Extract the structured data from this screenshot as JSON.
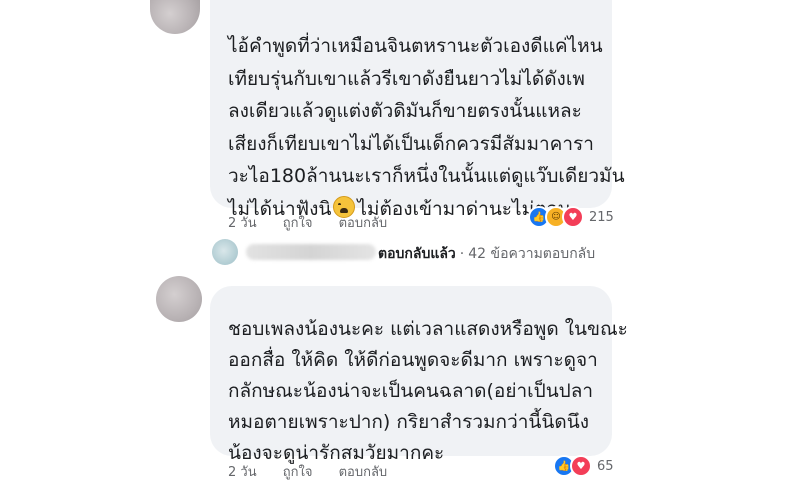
{
  "comments": [
    {
      "lines": [
        "ไอ้คำพูดที่ว่าเหมือนจินตหรานะตัวเองดีแค่ไหน",
        "เทียบรุ่นกับเขาแล้วรีเขาดังยืนยาวไม่ได้ดังเพ",
        "ลงเดียวแล้วดูแต่งตัวดิมันก็ขายตรงนั้นแหละ",
        "เสียงก็เทียบเขาไม่ได้เป็นเด็กควรมีสัมมาคารา",
        "วะไอ180ล้านนะเราก็หนึ่งในนั้นแต่ดูแว๊บเดียวมัน"
      ],
      "last_line_before_emoji": "ไม่ได้น่าฟังนิ",
      "last_line_after_emoji": "ไม่ต้องเข้ามาด่านะไม่ตอบ",
      "emoji": "weary-face",
      "time": "2 วัน",
      "like_label": "ถูกใจ",
      "reply_label": "ตอบกลับ",
      "reaction_count": "215",
      "reactions": [
        "like",
        "haha",
        "love"
      ]
    },
    {
      "lines": [
        "ชอบเพลงน้องนะคะ แต่เวลาแสดงหรือพูด ในขณะ",
        "ออกสื่อ ให้คิด ให้ดีก่อนพูดจะดีมาก เพราะดูจา",
        "กลักษณะน้องน่าจะเป็นคนฉลาด(อย่าเป็นปลา",
        "หมอตายเพราะปาก) กริยาสำรวมกว่านี้นิดนึง",
        "น้องจะดูน่ารักสมวัยมากคะ"
      ],
      "time": "2 วัน",
      "like_label": "ถูกใจ",
      "reply_label": "ตอบกลับ",
      "reaction_count": "65",
      "reactions": [
        "like",
        "love"
      ]
    }
  ],
  "reply_thread": {
    "replied_label": "ตอบกลับแล้ว",
    "separator": "·",
    "count_label": "42 ข้อความตอบกลับ"
  },
  "colors": {
    "bubble": "#f0f2f5",
    "meta_text": "#65676b",
    "like": "#1877f2",
    "haha": "#f7b125",
    "love": "#f33e58"
  }
}
